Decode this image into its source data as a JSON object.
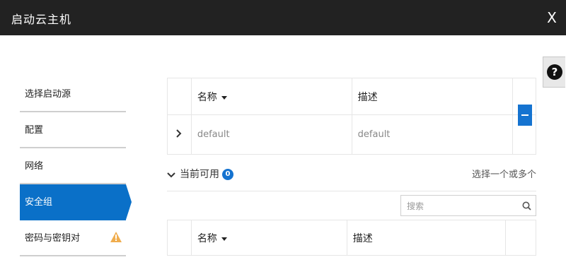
{
  "dialog": {
    "title": "启动云主机",
    "close_label": "X",
    "help_label": "?"
  },
  "nav": {
    "items": [
      {
        "label": "选择启动源"
      },
      {
        "label": "配置"
      },
      {
        "label": "网络"
      },
      {
        "label": "安全组"
      },
      {
        "label": "密码与密钥对"
      }
    ]
  },
  "allocated": {
    "columns": {
      "name": "名称",
      "description": "描述"
    },
    "rows": [
      {
        "name": "default",
        "description": "default"
      }
    ]
  },
  "available": {
    "title": "当前可用",
    "count": "0",
    "hint": "选择一个或多个",
    "search_placeholder": "搜索",
    "columns": {
      "name": "名称",
      "description": "描述"
    }
  },
  "colors": {
    "accent": "#1573d0",
    "nav_active": "#0a70c8",
    "warning": "#f0ad4e",
    "titlebar": "#222222"
  }
}
